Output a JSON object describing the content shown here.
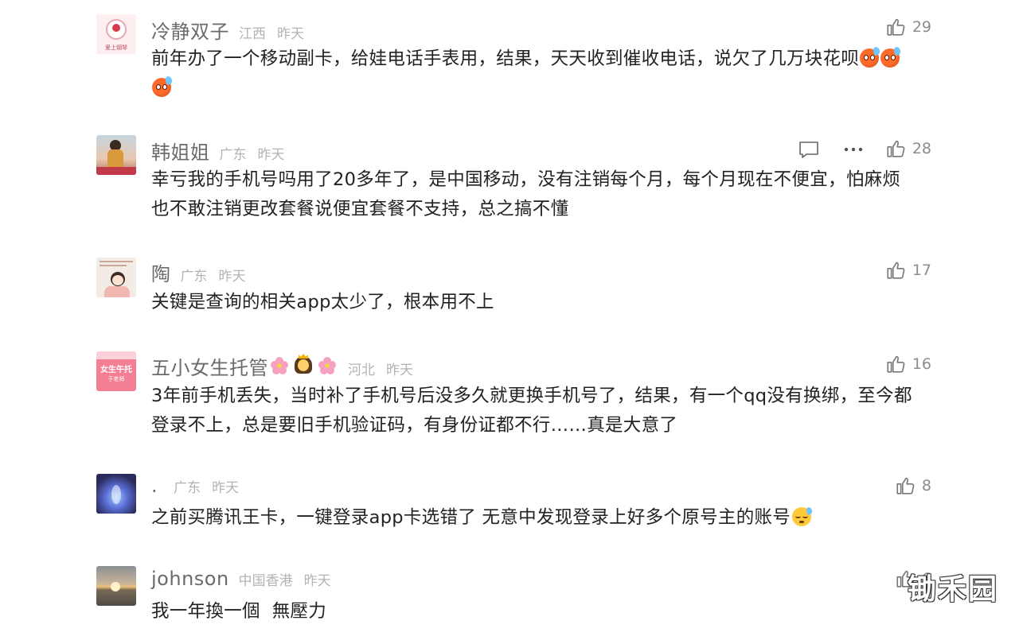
{
  "comments": [
    {
      "username": "冷静双子",
      "region": "江西",
      "time": "昨天",
      "text": "前年办了一个移动副卡，给娃电话手表用，结果，天天收到催收电话，说欠了几万块花呗",
      "emoji": "cold-sweat-emoji",
      "likes": "29"
    },
    {
      "username": "韩姐姐",
      "region": "广东",
      "time": "昨天",
      "text_line1": "幸亏我的手机号吗用了20多年了，是中国移动，没有注销每个月，每个月现在不便宜，怕麻烦",
      "text_line2": "也不敢注销更改套餐说便宜套餐不支持，总之搞不懂",
      "likes": "28"
    },
    {
      "username": "陶",
      "region": "广东",
      "time": "昨天",
      "text": "关键是查询的相关app太少了，根本用不上",
      "likes": "17"
    },
    {
      "username": "五小女生托管",
      "region": "河北",
      "time": "昨天",
      "text_line1": "3年前手机丢失，当时补了手机号后没多久就更换手机号了，结果，有一个qq没有换绑，至今都",
      "text_line2": "登录不上，总是要旧手机验证码，有身份证都不行……真是大意了",
      "likes": "16"
    },
    {
      "username": ".",
      "region": "广东",
      "time": "昨天",
      "text": "之前买腾讯王卡，一键登录app卡选错了 无意中发现登录上好多个原号主的账号",
      "likes": "8"
    },
    {
      "username": "johnson",
      "region": "中国香港",
      "time": "昨天",
      "text": "我一年換一個  無壓力",
      "likes": "6"
    }
  ],
  "avatar1_text": "爱上钢琴",
  "avatar4_text": "女生午托",
  "avatar4_sub": "于老师",
  "watermark": "锄禾园",
  "icons": {
    "like": "thumbs-up-icon",
    "reply": "comment-bubble-icon",
    "more": "more-dots-icon"
  }
}
